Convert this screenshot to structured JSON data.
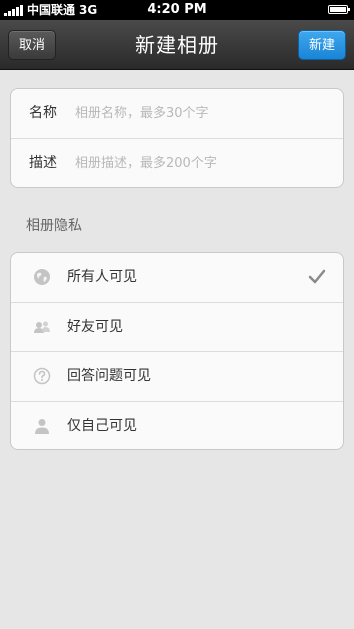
{
  "status_bar": {
    "carrier": "中国联通",
    "network": "3G",
    "time": "4:20 PM"
  },
  "nav": {
    "title": "新建相册",
    "cancel_label": "取消",
    "create_label": "新建"
  },
  "form": {
    "name_label": "名称",
    "name_placeholder": "相册名称，最多30个字",
    "name_value": "",
    "desc_label": "描述",
    "desc_placeholder": "相册描述，最多200个字",
    "desc_value": ""
  },
  "privacy": {
    "section_title": "相册隐私",
    "options": [
      {
        "label": "所有人可见",
        "icon": "globe-icon",
        "selected": true
      },
      {
        "label": "好友可见",
        "icon": "friends-icon",
        "selected": false
      },
      {
        "label": "回答问题可见",
        "icon": "question-icon",
        "selected": false
      },
      {
        "label": "仅自己可见",
        "icon": "person-icon",
        "selected": false
      }
    ]
  },
  "colors": {
    "accent": "#1f8fe0",
    "nav_background": "#333333",
    "page_background": "#e6e6e6"
  }
}
